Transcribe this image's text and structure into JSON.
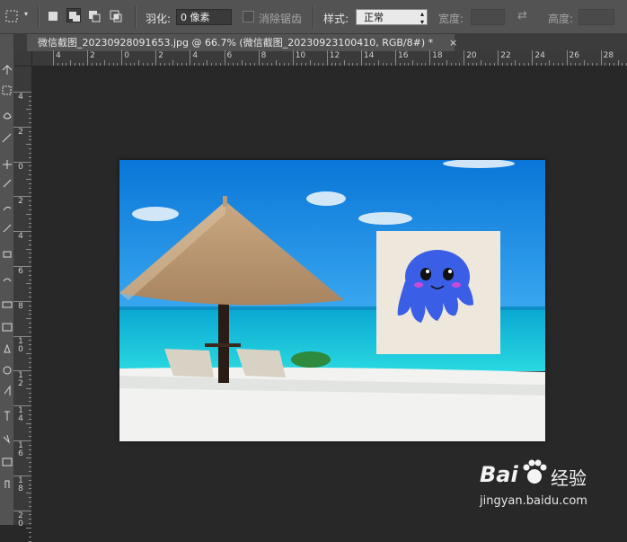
{
  "options_bar": {
    "feather_label": "羽化:",
    "feather_value": "0 像素",
    "antialias_label": "消除锯齿",
    "style_label": "样式:",
    "style_value": "正常",
    "width_label": "宽度:",
    "height_label": "高度:"
  },
  "document_tab": {
    "title": "微信截图_20230928091653.jpg @ 66.7% (微信截图_20230923100410, RGB/8#) *",
    "close": "×"
  },
  "ruler_h": [
    "4",
    "2",
    "0",
    "2",
    "4",
    "6",
    "8",
    "10",
    "12",
    "14",
    "16",
    "18",
    "20",
    "22",
    "24",
    "26",
    "28"
  ],
  "ruler_v": [
    "4",
    "2",
    "0",
    "2",
    "4",
    "6",
    "8",
    "10",
    "12",
    "14",
    "16",
    "18",
    "20"
  ],
  "watermark": {
    "brand": "Bai",
    "brand_suffix": "经验",
    "url": "jingyan.baidu.com"
  },
  "colors": {
    "panel": "#535353",
    "workspace": "#282828",
    "sky": "#1e90e8",
    "sea": "#16c4dc",
    "octopus": "#3b5ee6"
  }
}
